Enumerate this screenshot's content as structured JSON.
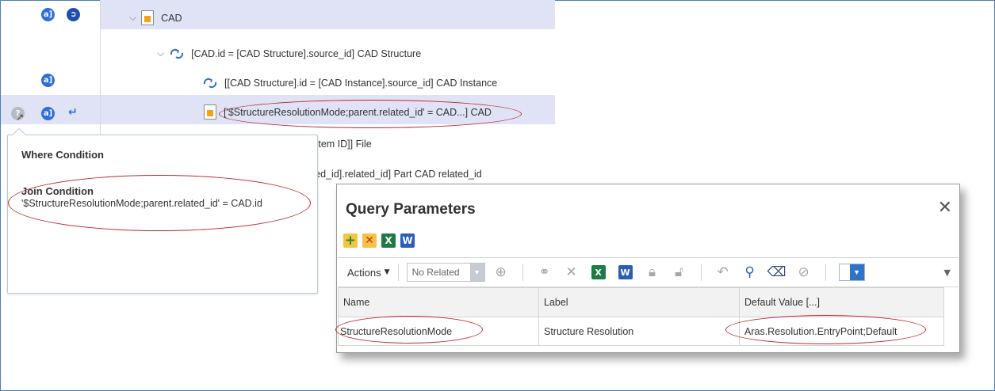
{
  "tree": {
    "rows": [
      {
        "label": "CAD"
      },
      {
        "label": "[CAD.id = [CAD Structure].source_id]  CAD Structure"
      },
      {
        "label": "[[CAD Structure].id = [CAD Instance].source_id]  CAD Instance"
      },
      {
        "label": "['$StructureResolutionMode;parent.related_id' = CAD...]  CAD"
      },
      {
        "label": "e.[Item ID]]  File"
      },
      {
        "label": "lated_id].related_id]  Part CAD related_id"
      }
    ],
    "icons": {
      "row0_a": "a]",
      "row2_a": "a]",
      "row3_a": "a]"
    }
  },
  "tooltip": {
    "title": "Where Condition",
    "subtitle": "Join Condition",
    "value": "'$StructureResolutionMode;parent.related_id' = CAD.id"
  },
  "dialog": {
    "title": "Query Parameters",
    "close": "✕",
    "toolbar": {
      "actions_label": "Actions",
      "select_value": "No Related"
    },
    "columns": [
      "Name",
      "Label",
      "Default Value [...]"
    ],
    "rows": [
      [
        "StructureResolutionMode",
        "Structure Resolution",
        "Aras.Resolution.EntryPoint;Default"
      ]
    ]
  },
  "colors": {
    "selected_row": "#dfe3f5",
    "annotation_red": "#c0282c",
    "accent_blue": "#2f6fd6"
  }
}
